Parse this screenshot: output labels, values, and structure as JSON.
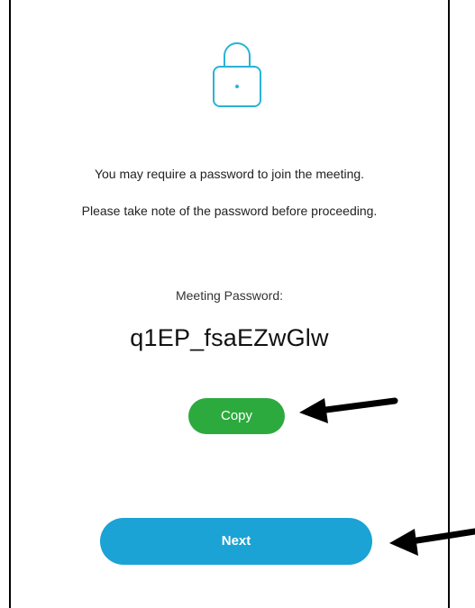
{
  "dialog": {
    "icon": "lock-icon",
    "message_line1": "You may require a password to join the meeting.",
    "message_line2": "Please take note of the password before proceeding.",
    "password_label": "Meeting Password:",
    "password_value": "q1EP_fsaEZwGlw",
    "copy_label": "Copy",
    "next_label": "Next"
  },
  "annotations": {
    "arrow_icon": "arrow-left-icon"
  },
  "colors": {
    "lock_accent": "#29b3d6",
    "copy_button": "#2daa3e",
    "next_button": "#1aa3d4"
  }
}
